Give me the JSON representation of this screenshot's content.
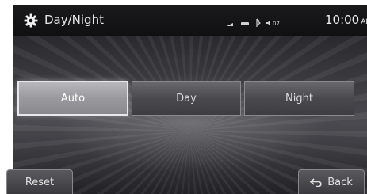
{
  "header": {
    "title": "Day/Night",
    "time": "10:00",
    "ampm": "AM",
    "icons": [
      "gear-icon",
      "antenna-icon",
      "battery-icon",
      "bluetooth-icon",
      "volume-icon"
    ]
  },
  "modes": {
    "auto": "Auto",
    "day": "Day",
    "night": "Night",
    "selected": "Auto"
  },
  "buttons": {
    "reset": "Reset",
    "back": "Back"
  },
  "colors": {
    "selected_bg": "#9a9a9e",
    "button_bg": "#4a4a4e",
    "text": "#e0e0e0"
  }
}
